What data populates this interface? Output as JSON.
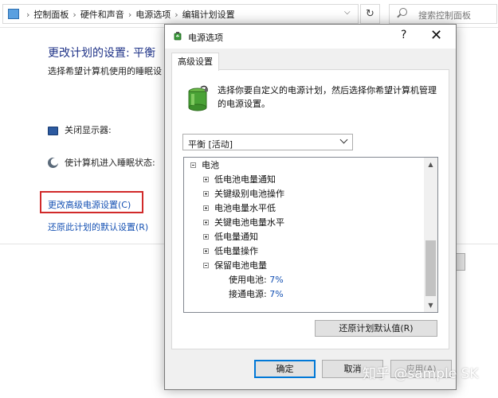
{
  "background_window": {
    "breadcrumbs": [
      "控制面板",
      "硬件和声音",
      "电源选项",
      "编辑计划设置"
    ],
    "search_placeholder": "搜索控制面板",
    "heading": "更改计划的设置: 平衡",
    "subtext": "选择希望计算机使用的睡眠设",
    "turn_off_display_label": "关闭显示器:",
    "sleep_label": "使计算机进入睡眠状态:",
    "advanced_link": "更改高级电源设置(C)",
    "restore_link": "还原此计划的默认设置(R)"
  },
  "dialog": {
    "title": "电源选项",
    "help": "?",
    "close": "✕",
    "tab_label": "高级设置",
    "description": "选择你要自定义的电源计划，然后选择你希望计算机管理的电源设置。",
    "plan_selected": "平衡 [活动]",
    "tree": {
      "root": "电池",
      "items": [
        "低电池电量通知",
        "关键级别电池操作",
        "电池电量水平低",
        "关键电池电量水平",
        "低电量通知",
        "低电量操作",
        "保留电池电量"
      ],
      "leaf_on_battery_label": "使用电池:",
      "leaf_on_battery_value": "7%",
      "leaf_plugged_label": "接通电源:",
      "leaf_plugged_value": "7%"
    },
    "restore_defaults_button": "还原计划默认值(R)",
    "ok_button": "确定",
    "cancel_button": "取消",
    "apply_button": "应用(A)"
  },
  "watermark": "知乎 @sample SK",
  "colors": {
    "link": "#1551b3",
    "highlight_box": "#d12a2a",
    "focus": "#0078d7"
  }
}
